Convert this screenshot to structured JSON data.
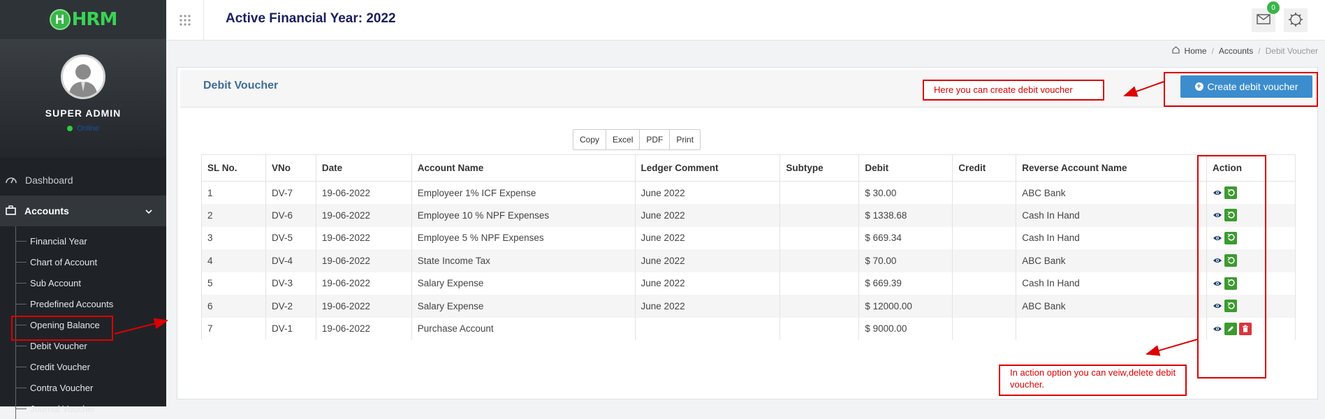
{
  "app": {
    "logo_letter": "H",
    "logo_text": "HRM"
  },
  "user": {
    "name": "SUPER ADMIN",
    "status": "Online"
  },
  "sidebar": {
    "dashboard": "Dashboard",
    "accounts": "Accounts",
    "sub_items": [
      "Financial Year",
      "Chart of Account",
      "Sub Account",
      "Predefined Accounts",
      "Opening Balance",
      "Debit Voucher",
      "Credit Voucher",
      "Contra Voucher",
      "Journal Voucher"
    ]
  },
  "header": {
    "title": "Active Financial Year: 2022",
    "notif_count": "0"
  },
  "breadcrumb": {
    "home": "Home",
    "accounts": "Accounts",
    "current": "Debit Voucher"
  },
  "panel": {
    "title": "Debit Voucher",
    "create_label": "Create debit voucher"
  },
  "export_buttons": [
    "Copy",
    "Excel",
    "PDF",
    "Print"
  ],
  "table": {
    "columns": [
      "SL No.",
      "VNo",
      "Date",
      "Account Name",
      "Ledger Comment",
      "Subtype",
      "Debit",
      "Credit",
      "Reverse Account Name",
      "Action"
    ],
    "rows": [
      [
        "1",
        "DV-7",
        "19-06-2022",
        "Employeer 1% ICF Expense",
        "June 2022",
        "",
        "$ 30.00",
        "",
        "ABC Bank"
      ],
      [
        "2",
        "DV-6",
        "19-06-2022",
        "Employee 10 % NPF Expenses",
        "June 2022",
        "",
        "$ 1338.68",
        "",
        "Cash In Hand"
      ],
      [
        "3",
        "DV-5",
        "19-06-2022",
        "Employee 5 % NPF Expenses",
        "June 2022",
        "",
        "$ 669.34",
        "",
        "Cash In Hand"
      ],
      [
        "4",
        "DV-4",
        "19-06-2022",
        "State Income Tax",
        "June 2022",
        "",
        "$ 70.00",
        "",
        "ABC Bank"
      ],
      [
        "5",
        "DV-3",
        "19-06-2022",
        "Salary Expense",
        "June 2022",
        "",
        "$ 669.39",
        "",
        "Cash In Hand"
      ],
      [
        "6",
        "DV-2",
        "19-06-2022",
        "Salary Expense",
        "June 2022",
        "",
        "$ 12000.00",
        "",
        "ABC Bank"
      ],
      [
        "7",
        "DV-1",
        "19-06-2022",
        "Purchase Account",
        "",
        "",
        "$ 9000.00",
        "",
        ""
      ]
    ],
    "row_actions": [
      [
        "view-icon",
        "reverse-icon"
      ],
      [
        "view-icon",
        "reverse-icon"
      ],
      [
        "view-icon",
        "reverse-icon"
      ],
      [
        "view-icon",
        "reverse-icon"
      ],
      [
        "view-icon",
        "reverse-icon"
      ],
      [
        "view-icon",
        "reverse-icon"
      ],
      [
        "view-icon",
        "edit-icon",
        "delete-icon"
      ]
    ]
  },
  "annotations": {
    "create_note": "Here you can create debit voucher",
    "action_note": "In action option you can veiw,delete debit voucher."
  },
  "colors": {
    "sidebar_bg": "#1f2328",
    "accent_blue": "#3c8dce",
    "action_green": "#3c9b2f",
    "delete_red": "#d9363e",
    "annotation_red": "#dd0000"
  }
}
